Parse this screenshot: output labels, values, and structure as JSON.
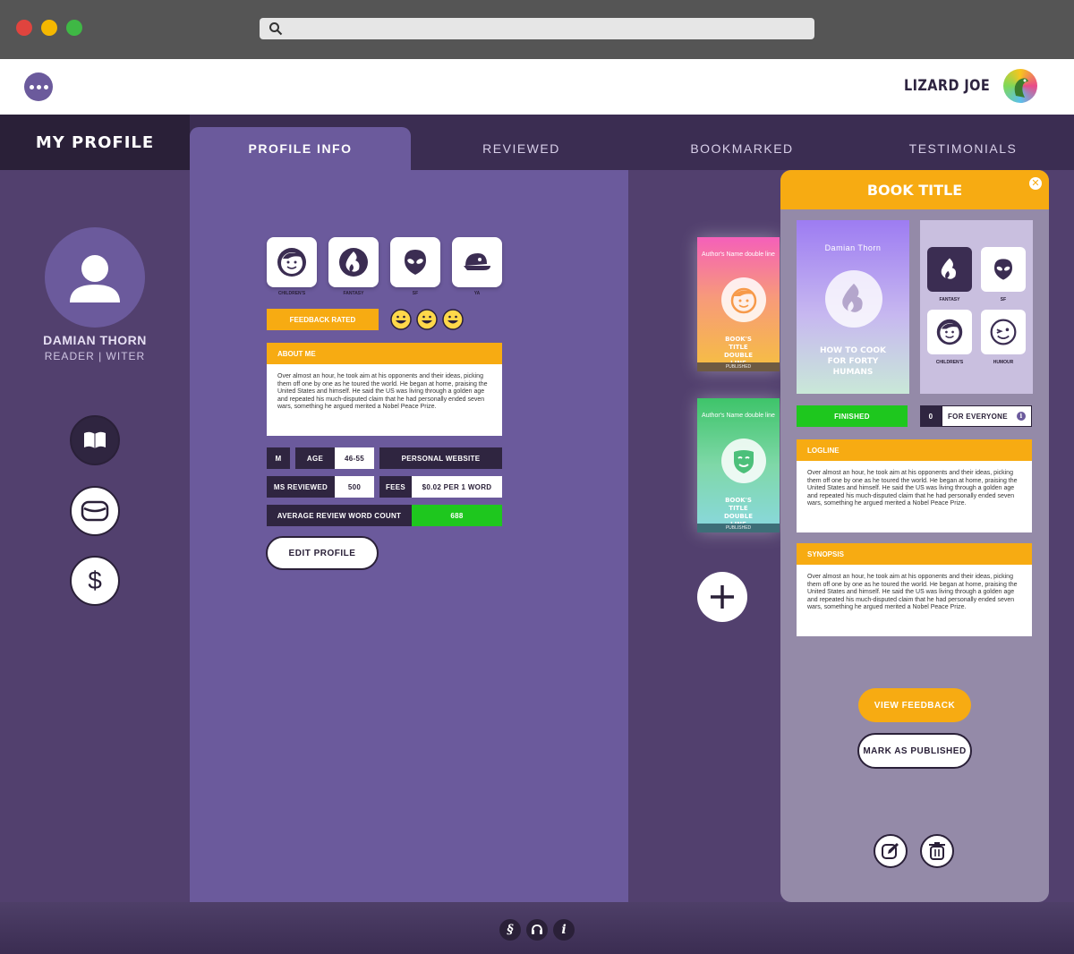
{
  "header": {
    "username": "LIZARD JOE"
  },
  "nav": {
    "my_profile": "MY PROFILE",
    "tabs": [
      {
        "label": "PROFILE INFO"
      },
      {
        "label": "REVIEWED"
      },
      {
        "label": "BOOKMARKED"
      },
      {
        "label": "TESTIMONIALS"
      }
    ]
  },
  "sidebar": {
    "name": "DAMIAN THORN",
    "role": "READER | WITER",
    "icons": [
      "book-icon",
      "mail-icon",
      "dollar-icon"
    ]
  },
  "profile": {
    "genres": [
      {
        "label": "CHILDREN'S",
        "icon": "child-face-icon"
      },
      {
        "label": "FANTASY",
        "icon": "dragon-icon"
      },
      {
        "label": "SF",
        "icon": "alien-icon"
      },
      {
        "label": "YA",
        "icon": "cap-icon"
      }
    ],
    "feedback_rated": "FEEDBACK RATED",
    "about_title": "ABOUT ME",
    "about_text": "Over almost an hour, he took aim at his opponents and their ideas, picking them off one by one as he toured the world. He began at home, praising the United States and himself. He said the US was living through a golden age and repeated his much-disputed claim that he had personally ended seven wars, something he argued merited a Nobel Peace Prize.",
    "gender": "M",
    "age_label": "AGE",
    "age_value": "46-55",
    "website": "PERSONAL WEBSITE",
    "ms_reviewed_label": "MS REVIEWED",
    "ms_reviewed_value": "500",
    "fees_label": "FEES",
    "fees_value": "$0.02 PER  1 WORD",
    "avg_label": "AVERAGE REVIEW WORD COUNT",
    "avg_value": "688",
    "edit_button": "EDIT PROFILE"
  },
  "books": [
    {
      "author": "Author's Name double line",
      "title": "BOOK'S TITLE DOUBLE LINE",
      "status": "PUBLISHED"
    },
    {
      "author": "Author's Name double line",
      "title": "BOOK'S TITLE DOUBLE LINE",
      "status": "PUBLISHED"
    }
  ],
  "detail": {
    "title": "BOOK TITLE",
    "cover_author": "Damian Thorn",
    "cover_title": "HOW TO COOK FOR FORTY HUMANS",
    "genres": [
      {
        "label": "FANTASY",
        "icon": "dragon-icon"
      },
      {
        "label": "SF",
        "icon": "alien-icon"
      },
      {
        "label": "CHILDREN'S",
        "icon": "child-face-icon"
      },
      {
        "label": "HUMOUR",
        "icon": "wink-icon"
      }
    ],
    "status": "FINISHED",
    "audience_count": "0",
    "audience": "FOR EVERYONE",
    "logline_title": "LOGLINE",
    "logline_text": "Over almost an hour, he took aim at his opponents and their ideas, picking them off one by one as he toured the world. He began at home, praising the United States and himself. He said the US was living through a golden age and repeated his much-disputed claim that he had personally ended seven wars, something he argued merited a Nobel Peace Prize.",
    "synopsis_title": "SYNOPSIS",
    "synopsis_text": "Over almost an hour, he took aim at his opponents and their ideas, picking them off one by one as he toured the world. He began at home, praising the United States and himself. He said the US was living through a golden age and repeated his much-disputed claim that he had personally ended seven wars, something he argued merited a Nobel Peace Prize.",
    "view_feedback": "VIEW FEEDBACK",
    "mark_published": "MARK AS PUBLISHED"
  },
  "colors": {
    "accent": "#f7ab12",
    "purple": "#6b5a9c",
    "dark": "#2a2038",
    "green": "#1ec71e"
  }
}
